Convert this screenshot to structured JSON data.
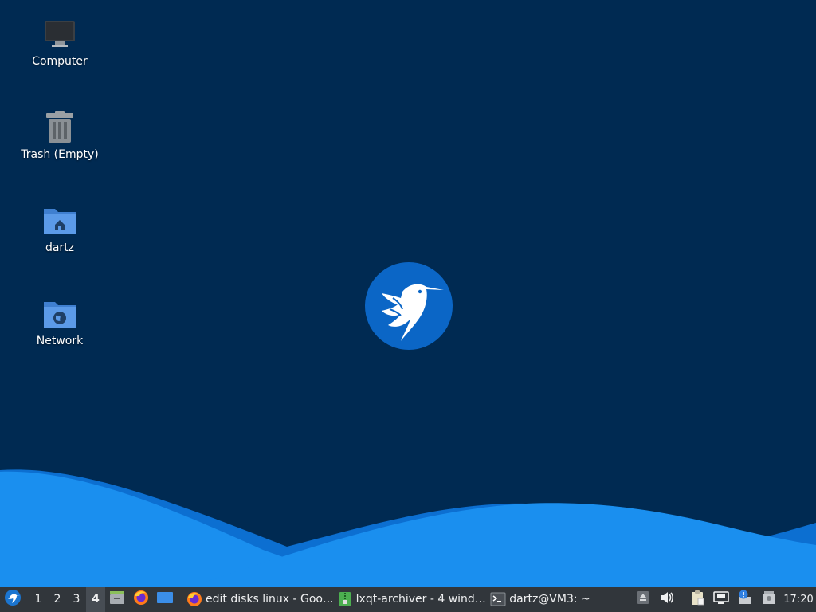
{
  "desktop": {
    "icons": [
      {
        "label": "Computer",
        "icon": "computer-icon",
        "selected": true
      },
      {
        "label": "Trash (Empty)",
        "icon": "trash-icon",
        "selected": false
      },
      {
        "label": "dartz",
        "icon": "home-folder-icon",
        "selected": false
      },
      {
        "label": "Network",
        "icon": "network-folder-icon",
        "selected": false
      }
    ],
    "wallpaper_logo": "lubuntu-logo"
  },
  "taskbar": {
    "menu_icon": "lubuntu-menu-icon",
    "desktops": [
      "1",
      "2",
      "3",
      "4"
    ],
    "active_desktop": "4",
    "quicklaunch": [
      "file-manager-icon",
      "firefox-icon",
      "show-desktop-icon"
    ],
    "tasks": [
      {
        "label": "edit disks linux - Goo…",
        "icon": "firefox-icon"
      },
      {
        "label": "lxqt-archiver - 4 wind…",
        "icon": "archiver-icon"
      },
      {
        "label": "dartz@VM3: ~",
        "icon": "terminal-icon"
      }
    ],
    "tray": [
      "eject-icon",
      "volume-icon",
      "clipboard-icon",
      "network-wired-icon",
      "update-notifier-icon",
      "removable-drive-icon"
    ],
    "clock": "17:20"
  },
  "colors": {
    "background": "#002a52",
    "wave_light": "#1a8fef",
    "wave_dark": "#0c6fd1",
    "taskbar": "#31363b",
    "logo": "#0b66c6"
  }
}
